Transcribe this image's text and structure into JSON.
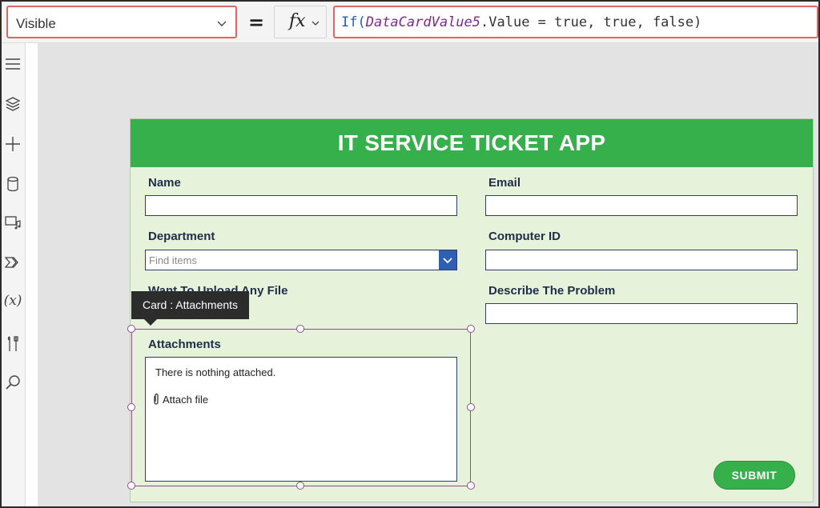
{
  "formula_bar": {
    "property": "Visible",
    "equals": "=",
    "fx_label": "fx",
    "formula": {
      "fn": "If(",
      "var": "DataCardValue5",
      "rest": ".Value = true, true, false)"
    }
  },
  "left_rail": {
    "items": [
      {
        "icon": "hamburger-icon"
      },
      {
        "icon": "layers-icon"
      },
      {
        "icon": "plus-icon"
      },
      {
        "icon": "database-icon"
      },
      {
        "icon": "media-icon"
      },
      {
        "icon": "power-automate-icon"
      },
      {
        "icon": "variables-icon",
        "text": "(x)"
      },
      {
        "icon": "tools-icon"
      },
      {
        "icon": "search-icon"
      }
    ]
  },
  "app": {
    "title": "IT SERVICE TICKET APP",
    "fields": {
      "name_label": "Name",
      "email_label": "Email",
      "department_label": "Department",
      "department_placeholder": "Find items",
      "computer_id_label": "Computer ID",
      "upload_label": "Want To Upload Any File",
      "describe_label": "Describe The Problem",
      "attachments_label": "Attachments",
      "attachments_empty": "There is nothing attached.",
      "attach_file": "Attach file"
    },
    "submit_label": "SUBMIT"
  },
  "selection": {
    "tooltip": "Card : Attachments"
  },
  "colors": {
    "header_green": "#36b04b",
    "form_background": "#e6f3da",
    "highlight_red": "#e06666",
    "selection_purple": "#8c4f8c",
    "input_border": "#2f3e66",
    "dropdown_blue": "#2f5fb3"
  }
}
